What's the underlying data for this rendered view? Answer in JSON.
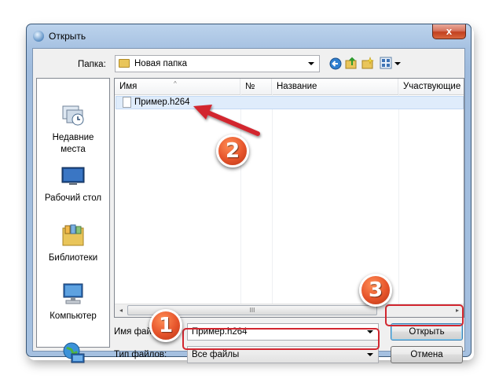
{
  "window": {
    "title": "Открыть",
    "close_glyph": "x"
  },
  "toolbar": {
    "folder_label": "Папка:",
    "folder_value": "Новая папка",
    "icons": [
      "back-icon",
      "up-folder-icon",
      "new-folder-icon",
      "view-menu-icon"
    ]
  },
  "places": [
    {
      "label": "Недавние\nместа",
      "icon": "recent-places-icon"
    },
    {
      "label": "Рабочий стол",
      "icon": "desktop-icon"
    },
    {
      "label": "Библиотеки",
      "icon": "libraries-icon"
    },
    {
      "label": "Компьютер",
      "icon": "computer-icon"
    },
    {
      "label": "",
      "icon": "network-icon"
    }
  ],
  "file_list": {
    "columns": [
      "Имя",
      "№",
      "Название",
      "Участвующие и"
    ],
    "rows": [
      {
        "name": "Пример.h264"
      }
    ],
    "scroll_left": "◂",
    "scroll_right": "▸",
    "scroll_grip": "III"
  },
  "footer": {
    "filename_label": "Имя файла:",
    "filename_value": "Пример.h264",
    "filetype_label": "Тип файлов:",
    "filetype_value": "Все файлы",
    "open_button": "Открыть",
    "cancel_button": "Отмена"
  },
  "annotations": {
    "badge1": "1",
    "badge2": "2",
    "badge3": "3",
    "color": "#d2262f"
  }
}
